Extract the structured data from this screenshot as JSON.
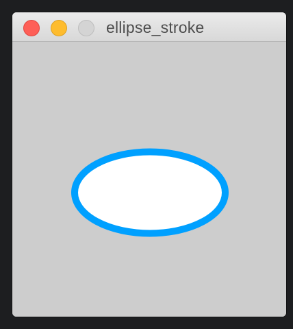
{
  "window": {
    "title": "ellipse_stroke",
    "controls": {
      "close": "close",
      "minimize": "minimize",
      "zoom": "zoom"
    }
  },
  "canvas": {
    "background_color": "#cdcdcd",
    "shape": {
      "type": "ellipse",
      "fill_color": "#ffffff",
      "stroke_color": "#00a0ff"
    }
  }
}
